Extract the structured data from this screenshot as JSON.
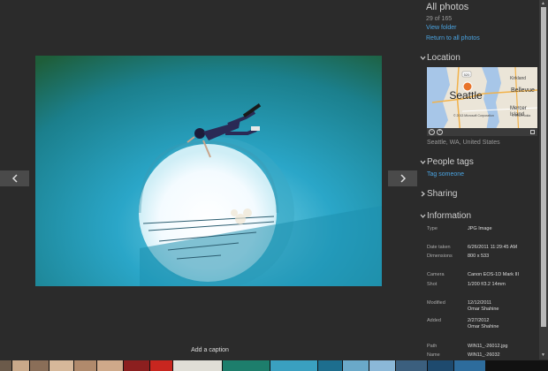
{
  "panel": {
    "title": "All photos",
    "count": "29 of 165",
    "view_folder": "View folder",
    "return_link": "Return to all photos",
    "location_header": "Location",
    "location_text": "Seattle, WA, United States",
    "people_header": "People tags",
    "tag_someone": "Tag someone",
    "sharing_header": "Sharing",
    "information_header": "Information"
  },
  "map": {
    "city": "Seattle",
    "bellevue": "Bellevue",
    "mercer": "Mercer",
    "island": "Island",
    "kirkland": "Kirkland",
    "road": "520",
    "copyright": "© 2013 Microsoft Corporation",
    "copyright2": "© 2013 Nokia"
  },
  "info": {
    "type_label": "Type",
    "type_value": "JPG Image",
    "date_label": "Date taken",
    "date_value": "6/26/2011 11:29:45 AM",
    "dim_label": "Dimensions",
    "dim_value": "800 x 533",
    "camera_label": "Camera",
    "camera_value": "Canon EOS-1D Mark III",
    "shot_label": "Shot",
    "shot_value": "1/200 f/3.2 14mm",
    "modified_label": "Modified",
    "modified_value": "12/12/2011",
    "modified_by": "Omar Shahine",
    "added_label": "Added",
    "added_value": "2/27/2012",
    "added_by": "Omar Shahine",
    "path_label": "Path",
    "path_value": "WIN11_-26012.jpg",
    "name_label": "Name",
    "name_value": "WIN11_-26032"
  },
  "viewer": {
    "caption_placeholder": "Add a caption"
  },
  "colors": {
    "accent": "#4aa3e0",
    "background": "#2b2b2b",
    "pin": "#e8742a"
  },
  "icons": {
    "prev": "chevron-left-icon",
    "next": "chevron-right-icon",
    "section": "chevron-down-icon",
    "sharing": "chevron-right-icon"
  }
}
